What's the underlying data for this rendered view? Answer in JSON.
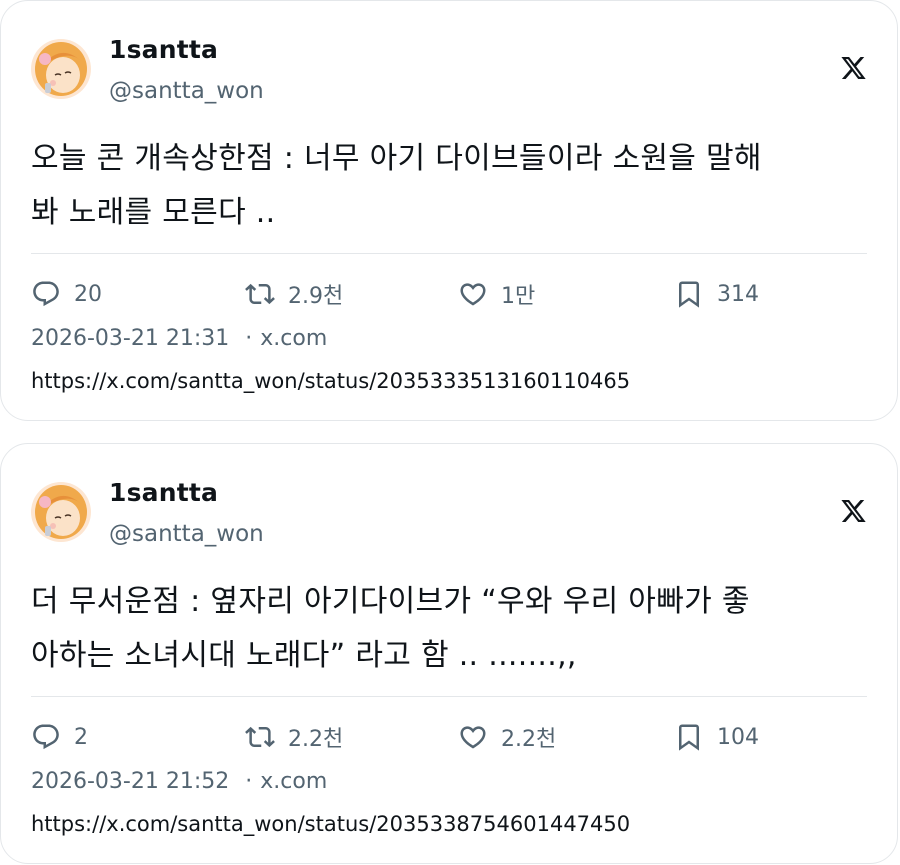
{
  "tweets": [
    {
      "author": {
        "name": "1santta",
        "handle": "@santta_won"
      },
      "text": [
        "오늘 콘 개속상한점 : 너무 아기 다이브들이라 소원을 말해",
        "봐 노래를 모른다 .."
      ],
      "stats": {
        "replies": "20",
        "retweets": "2.9천",
        "likes": "1만",
        "bookmarks": "314"
      },
      "timestamp": "2026-03-21 21:31",
      "dot": "·",
      "source": "x.com",
      "url": "https://x.com/santta_won/status/2035333513160110465"
    },
    {
      "author": {
        "name": "1santta",
        "handle": "@santta_won"
      },
      "text": [
        "더 무서운점 : 옆자리 아기다이브가 “우와 우리 아빠가 좋",
        "아하는 소녀시대 노래다” 라고 함 .. .......,,"
      ],
      "stats": {
        "replies": "2",
        "retweets": "2.2천",
        "likes": "2.2천",
        "bookmarks": "104"
      },
      "timestamp": "2026-03-21 21:52",
      "dot": "·",
      "source": "x.com",
      "url": "https://x.com/santta_won/status/2035338754601447450"
    }
  ],
  "icons": {
    "brand": "x-logo-icon",
    "reply": "reply-icon",
    "retweet": "retweet-icon",
    "like": "heart-icon",
    "bookmark": "bookmark-icon"
  }
}
